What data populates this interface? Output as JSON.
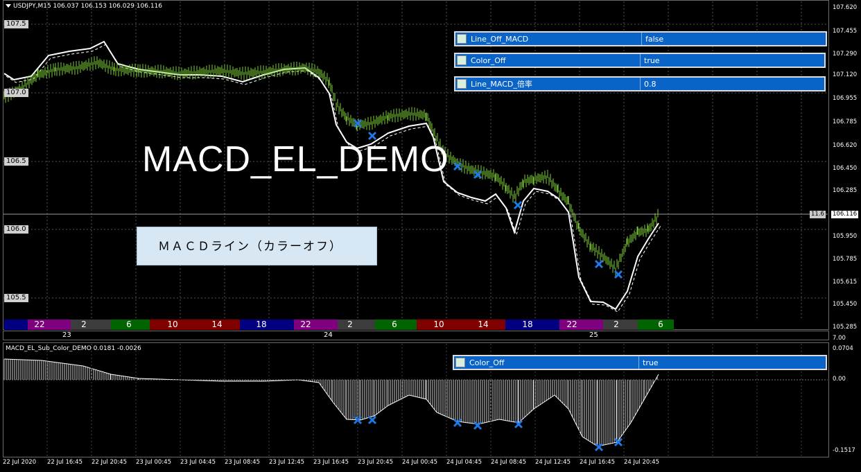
{
  "header": {
    "symbol_info": "USDJPY,M15  106.037 106.153 106.029 106.116"
  },
  "main_title": "MACD_EL_DEMO",
  "note_box": "ＭＡＣＤライン（カラーオフ）",
  "price_axis": [
    "107.620",
    "107.455",
    "107.290",
    "107.120",
    "106.955",
    "106.785",
    "106.620",
    "106.450",
    "106.285",
    "106.116",
    "105.950",
    "105.785",
    "105.615",
    "105.450",
    "105.285"
  ],
  "left_levels": [
    "107.5",
    "107.0",
    "106.5",
    "106.0",
    "105.5"
  ],
  "current": {
    "price": "106.116",
    "macd_hist": "11.6"
  },
  "params_main": [
    {
      "name": "Line_Off_MACD",
      "value": "false",
      "icon": "chart-icon"
    },
    {
      "name": "Color_Off",
      "value": "true",
      "icon": "chart-icon"
    },
    {
      "name": "Line_MACD_倍率",
      "value": "0.8",
      "icon": "number-icon"
    }
  ],
  "params_sub": [
    {
      "name": "Color_Off",
      "value": "true",
      "icon": "chart-icon"
    }
  ],
  "session_labels": [
    "22",
    "2",
    "6",
    "10",
    "14",
    "18",
    "22",
    "2",
    "6",
    "10",
    "14",
    "18",
    "22",
    "2",
    "6"
  ],
  "session_colors": {
    "asia": "#000080",
    "europe_a": "#800080",
    "europe_b": "#3c3c3c",
    "europe_c": "#006400",
    "ny": "#800000"
  },
  "day_labels": [
    "23",
    "24",
    "25"
  ],
  "subwindow": {
    "title": "MACD_EL_Sub_Color_DEMO 0.0181 -0.0026",
    "axis": [
      "0.0704",
      "0.00",
      "-0.1517"
    ],
    "axis_extra": "7.00"
  },
  "time_axis": [
    "22 Jul 2020",
    "22 Jul 16:45",
    "22 Jul 20:45",
    "23 Jul 00:45",
    "23 Jul 04:45",
    "23 Jul 08:45",
    "23 Jul 12:45",
    "23 Jul 16:45",
    "23 Jul 20:45",
    "24 Jul 00:45",
    "24 Jul 04:45",
    "24 Jul 08:45",
    "24 Jul 12:45",
    "24 Jul 16:45",
    "24 Jul 20:45"
  ],
  "colors": {
    "candle": "#7fd13a",
    "cross": "#1e78e6",
    "param_bg": "#0a64c8"
  }
}
